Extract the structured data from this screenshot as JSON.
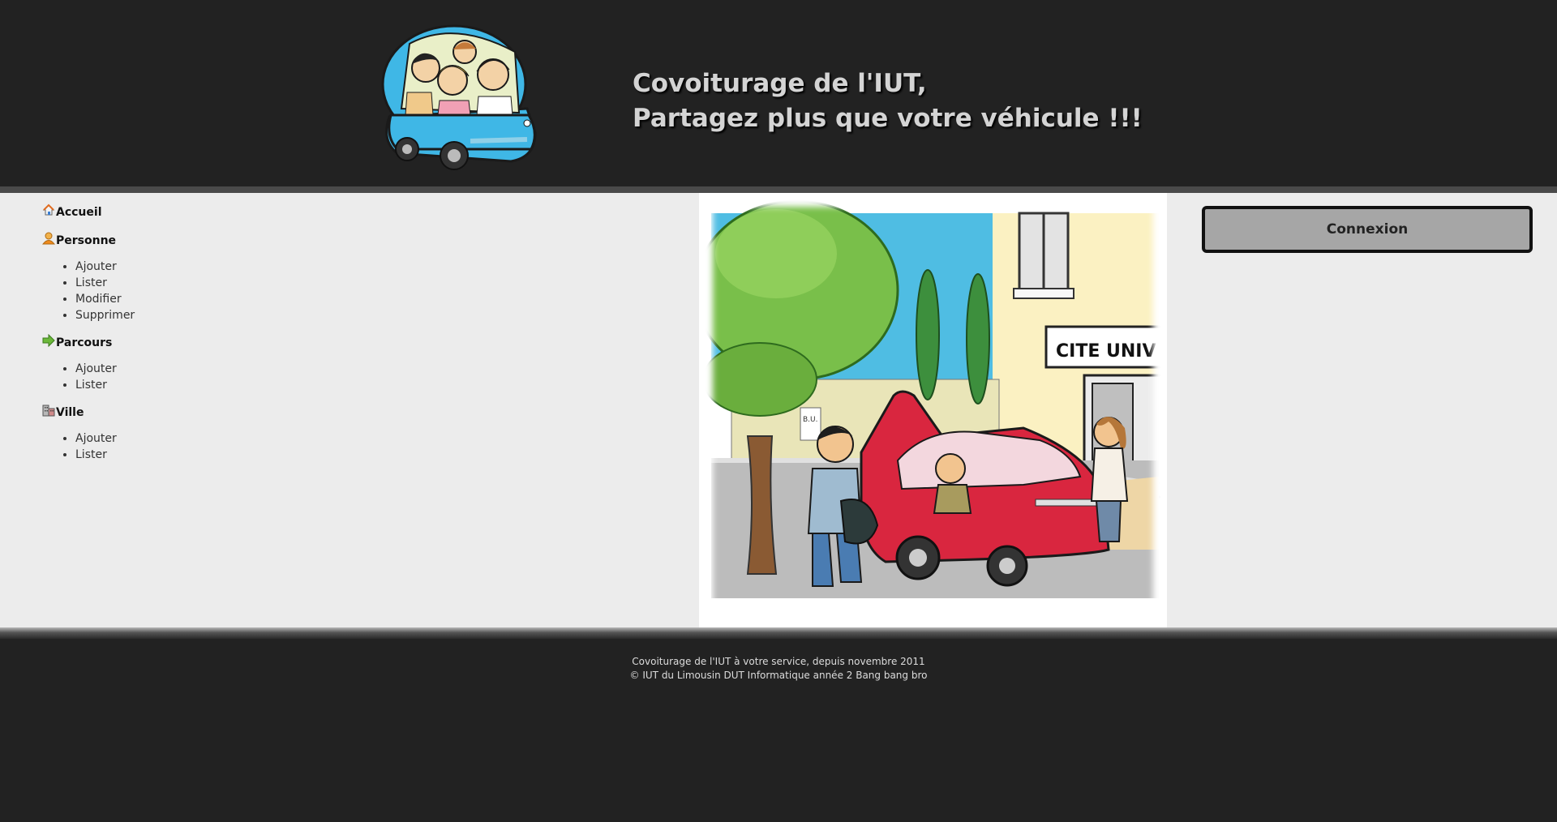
{
  "header": {
    "title_line1": "Covoiturage de l'IUT,",
    "title_line2": "Partagez plus que votre véhicule !!!"
  },
  "menu": {
    "accueil": "Accueil",
    "personne": {
      "label": "Personne",
      "items": [
        "Ajouter",
        "Lister",
        "Modifier",
        "Supprimer"
      ]
    },
    "parcours": {
      "label": "Parcours",
      "items": [
        "Ajouter",
        "Lister"
      ]
    },
    "ville": {
      "label": "Ville",
      "items": [
        "Ajouter",
        "Lister"
      ]
    }
  },
  "illustration": {
    "sign_text": "CITE UNIV",
    "bu_text": "B.U."
  },
  "login": {
    "button_label": "Connexion"
  },
  "footer": {
    "line1": "Covoiturage de l'IUT à votre service, depuis novembre 2011",
    "line2": "© IUT du Limousin DUT Informatique année 2 Bang bang bro"
  },
  "colors": {
    "background_dark": "#222222",
    "main_background": "#ececec",
    "button_background": "#a6a6a6",
    "title_color": "#d4d4d4"
  },
  "icons": [
    "home-icon",
    "person-icon",
    "arrow-right-icon",
    "building-icon",
    "car-logo-icon"
  ]
}
